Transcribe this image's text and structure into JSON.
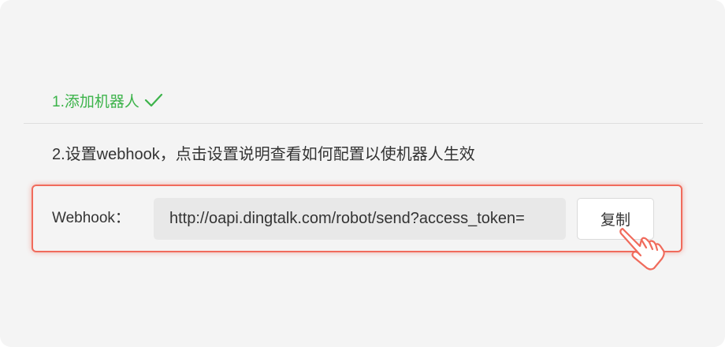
{
  "step1": {
    "label": "1.添加机器人"
  },
  "step2": {
    "label": "2.设置webhook，点击设置说明查看如何配置以使机器人生效"
  },
  "webhook": {
    "label": "Webhook：",
    "url": "http://oapi.dingtalk.com/robot/send?access_token=",
    "copy_label": "复制"
  },
  "colors": {
    "success": "#3cb34a",
    "highlight": "#f06b5c",
    "text": "#333333",
    "background": "#f4f4f4"
  },
  "icons": {
    "step1_status": "check-icon",
    "pointer": "hand-pointer-icon"
  }
}
